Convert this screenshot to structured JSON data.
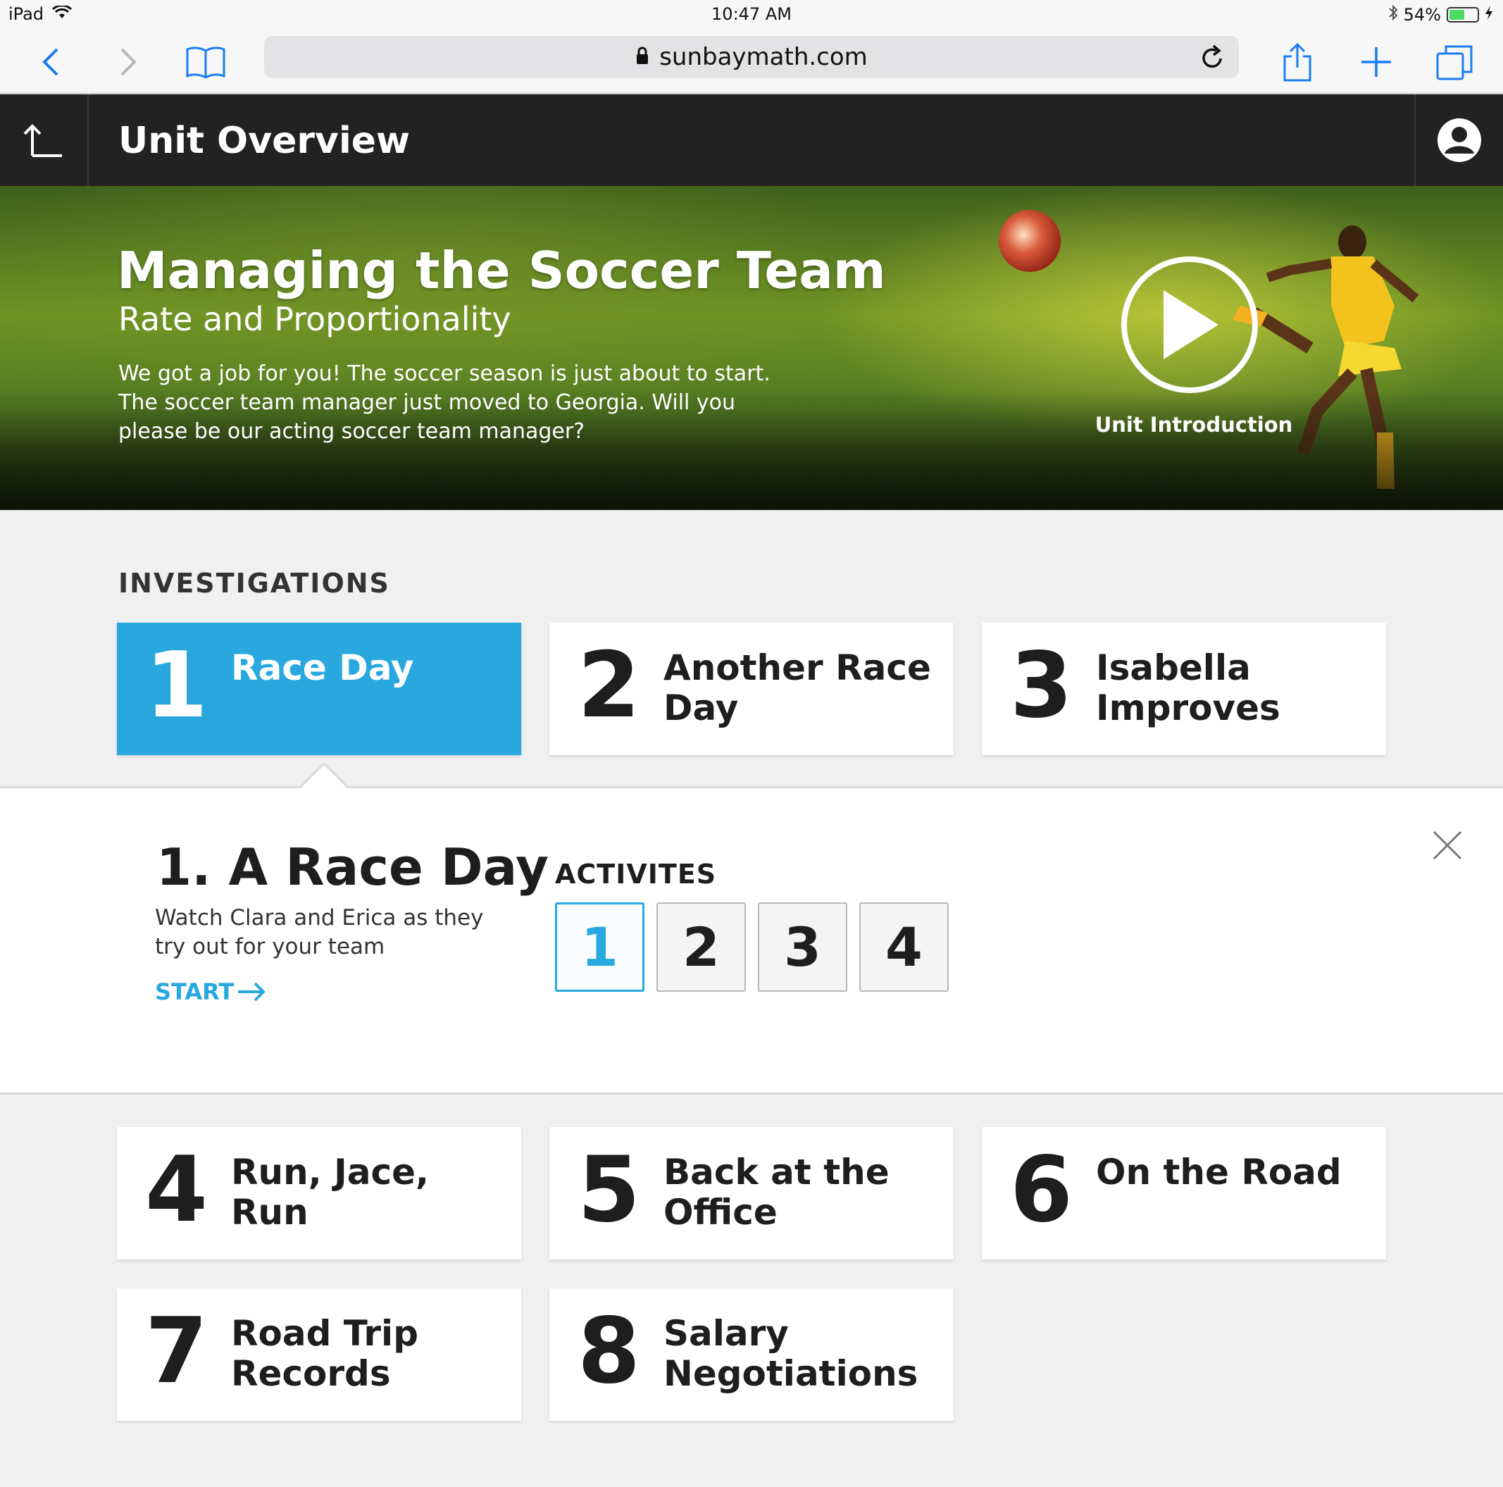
{
  "status_bar": {
    "device": "iPad",
    "time": "10:47 AM",
    "battery": "54%",
    "battery_level": 0.54
  },
  "browser": {
    "url": "sunbaymath.com"
  },
  "navbar": {
    "title": "Unit Overview"
  },
  "hero": {
    "title": "Managing the Soccer Team",
    "subtitle": "Rate and Proportionality",
    "description": "We got a job for you! The soccer season is just about to start. The soccer team manager just moved to Georgia. Will you please be our acting soccer team manager?",
    "video_label": "Unit Introduction"
  },
  "investigations": {
    "heading": "INVESTIGATIONS",
    "items": [
      {
        "num": "1",
        "title": "Race Day",
        "active": true
      },
      {
        "num": "2",
        "title": "Another Race Day"
      },
      {
        "num": "3",
        "title": "Isabella Improves"
      },
      {
        "num": "4",
        "title": "Run, Jace, Run"
      },
      {
        "num": "5",
        "title": "Back at the Office"
      },
      {
        "num": "6",
        "title": "On the Road"
      },
      {
        "num": "7",
        "title": "Road Trip Records"
      },
      {
        "num": "8",
        "title": "Salary Negotiations"
      }
    ]
  },
  "detail": {
    "title": "1. A Race Day",
    "description": "Watch Clara and Erica as they try out for your team",
    "start": "START",
    "activities_heading": "ACTIVITES",
    "activities": [
      "1",
      "2",
      "3",
      "4"
    ]
  },
  "colors": {
    "accent": "#29a8e0",
    "navbar": "#222222"
  }
}
